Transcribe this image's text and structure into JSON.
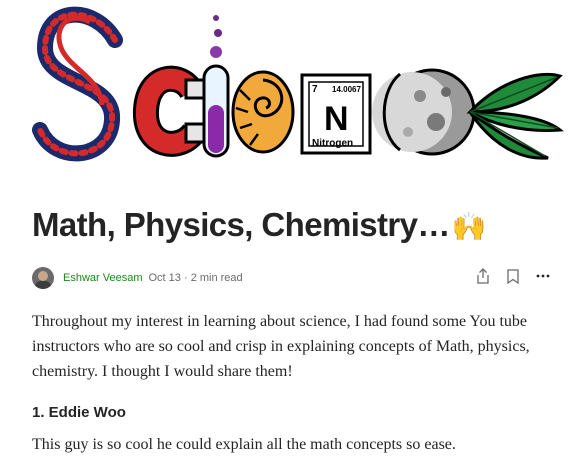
{
  "hero": {
    "element_card": {
      "number": "7",
      "mass": "14.0067",
      "symbol": "N",
      "name": "Nitrogen"
    }
  },
  "article": {
    "title": "Math, Physics, Chemistry…",
    "title_emoji": "🙌",
    "author": "Eshwar Veesam",
    "date": "Oct 13",
    "separator": "·",
    "read_time": "2 min read",
    "paragraph1": "Throughout my interest in learning about science, I had found some You tube instructors who are so cool and crisp in explaining concepts of Math, physics, chemistry. I thought I would share them!",
    "heading1": "1. Eddie Woo",
    "paragraph2": "This guy is so cool he could explain all the math concepts so ease."
  },
  "icons": {
    "share": "share-icon",
    "bookmark": "bookmark-icon",
    "more": "more-icon"
  },
  "colors": {
    "author_green": "#1a8917",
    "text": "#242424",
    "muted": "#6b6b6b"
  }
}
